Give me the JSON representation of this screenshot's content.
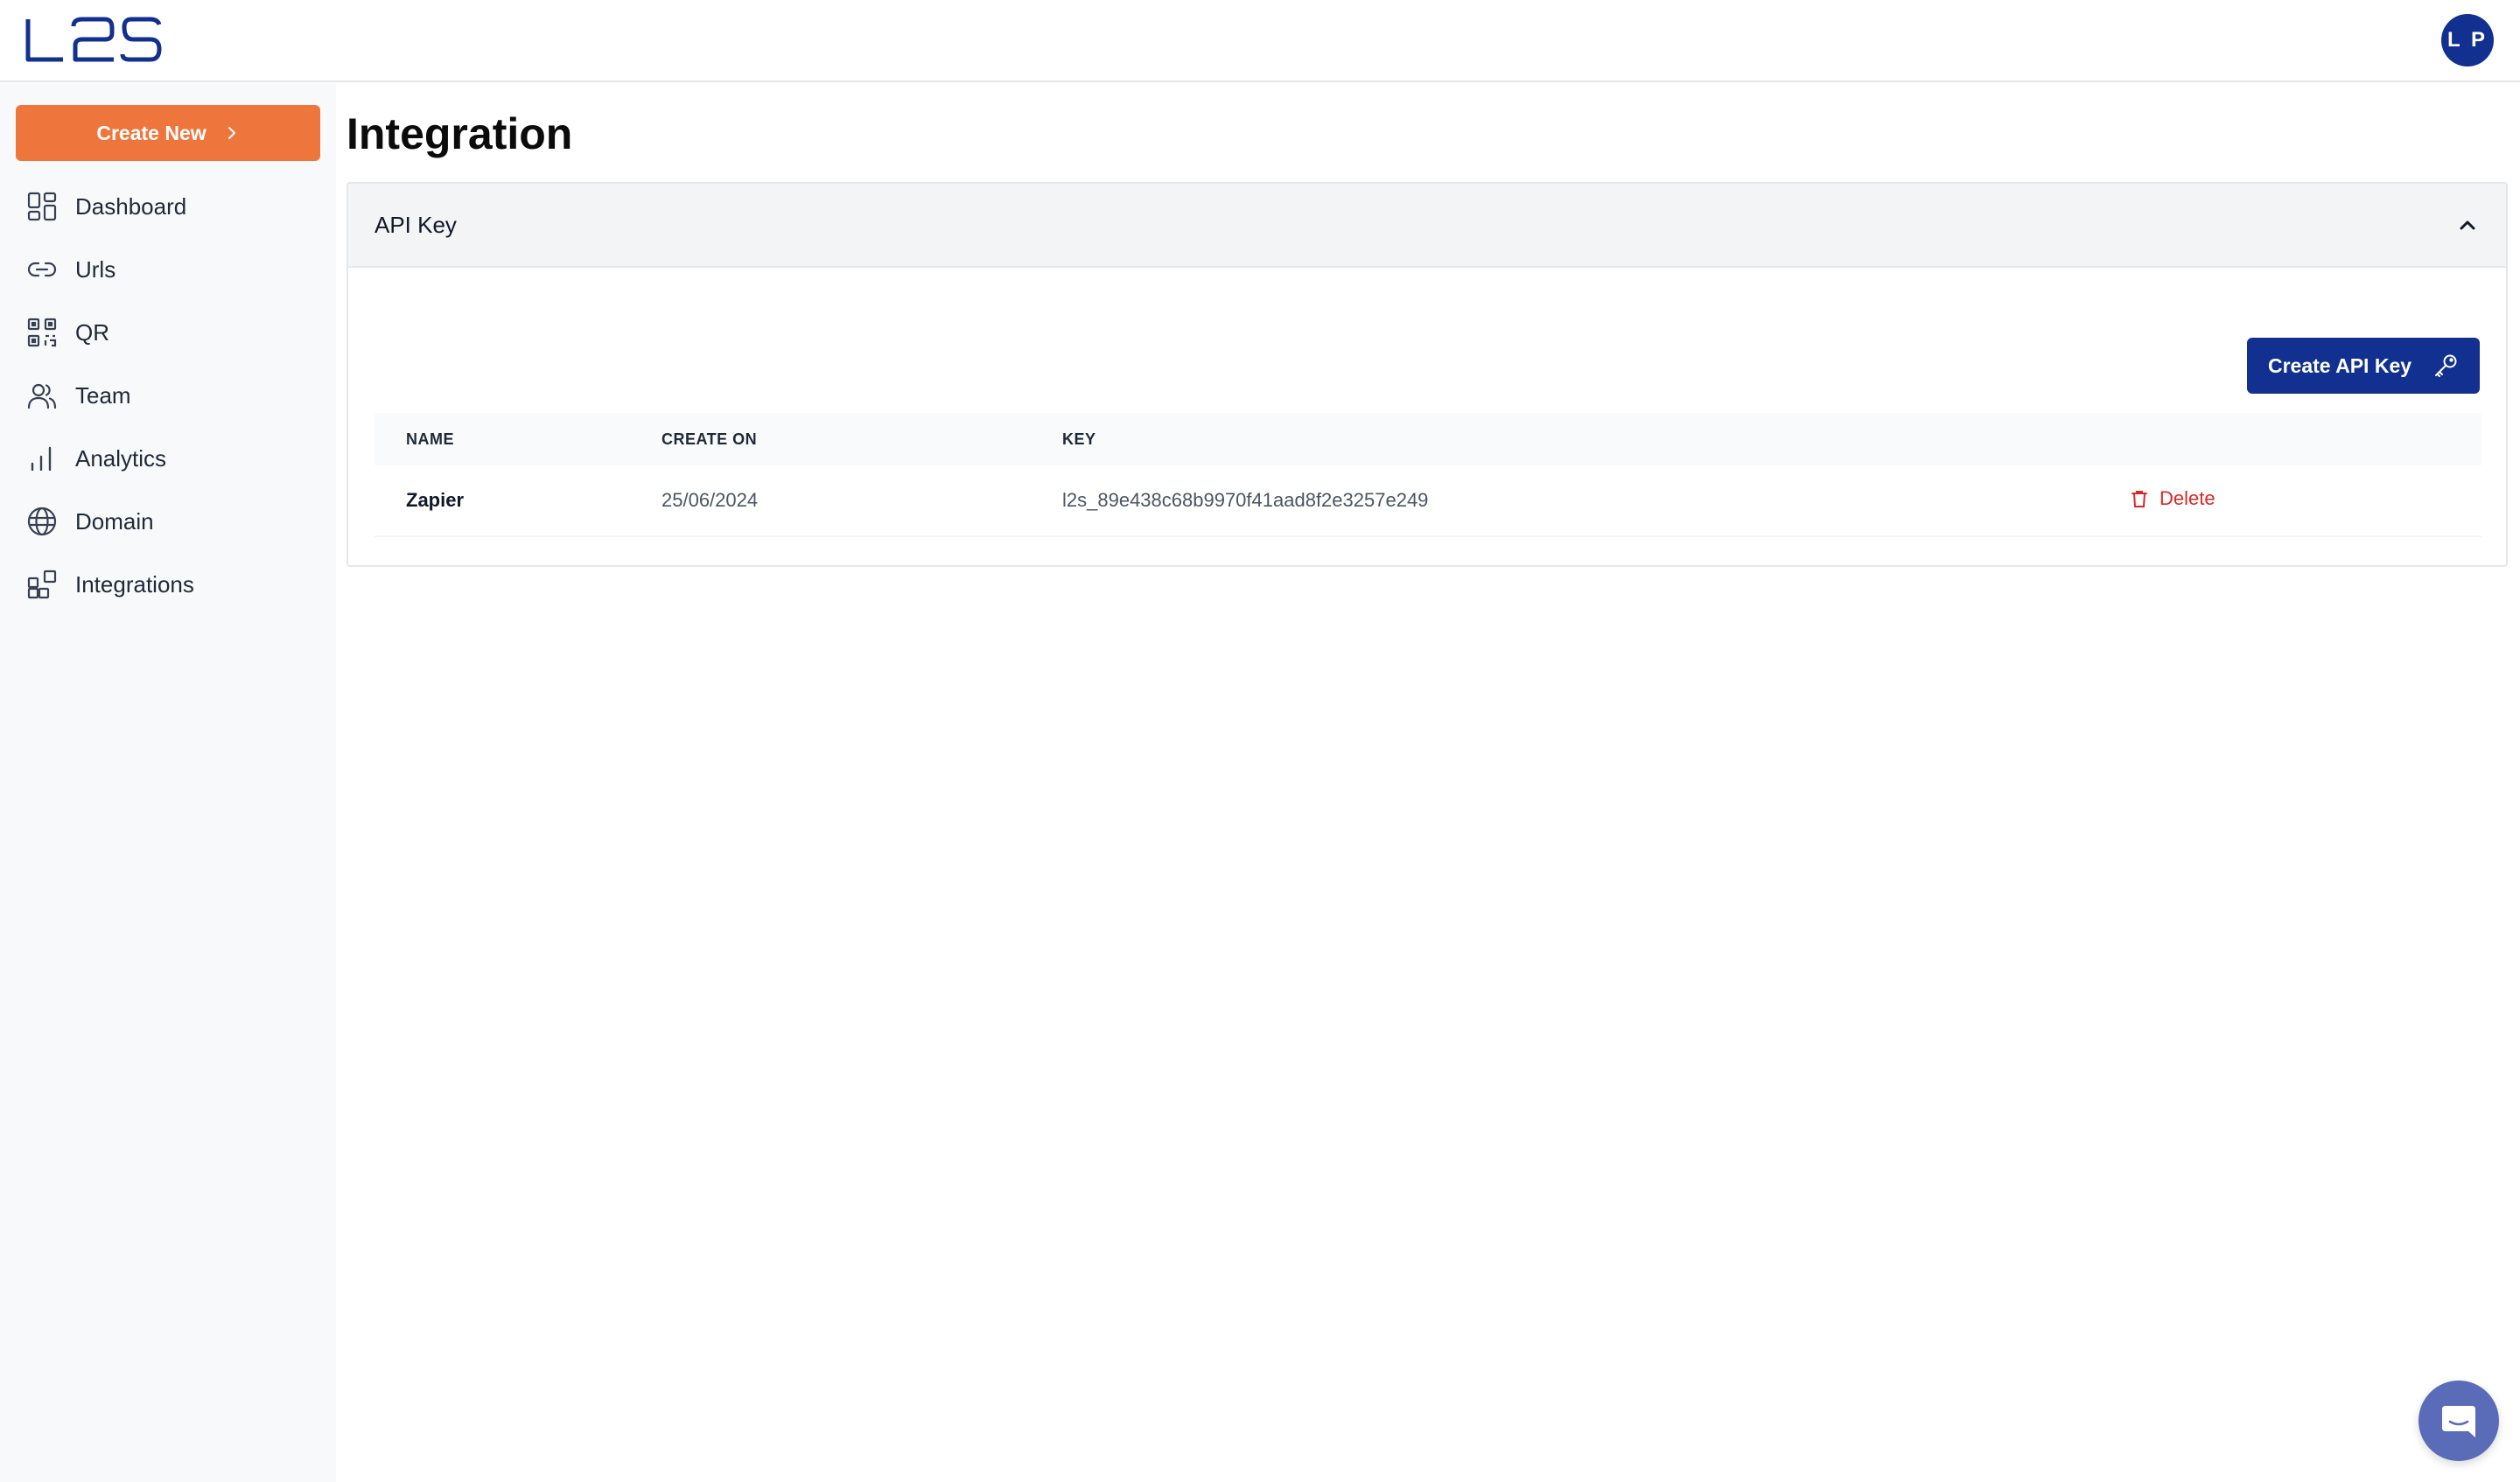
{
  "header": {
    "logo_text": "L2S",
    "avatar_initials": "L P"
  },
  "sidebar": {
    "create_new_label": "Create New",
    "items": [
      {
        "label": "Dashboard",
        "icon": "dashboard-icon"
      },
      {
        "label": "Urls",
        "icon": "link-icon"
      },
      {
        "label": "QR",
        "icon": "qr-icon"
      },
      {
        "label": "Team",
        "icon": "team-icon"
      },
      {
        "label": "Analytics",
        "icon": "analytics-icon"
      },
      {
        "label": "Domain",
        "icon": "globe-icon"
      },
      {
        "label": "Integrations",
        "icon": "integrations-icon"
      }
    ]
  },
  "main": {
    "title": "Integration",
    "panel": {
      "title": "API Key",
      "create_button_label": "Create API Key",
      "columns": [
        "NAME",
        "CREATE ON",
        "KEY"
      ],
      "rows": [
        {
          "name": "Zapier",
          "created_on": "25/06/2024",
          "key": "l2s_89e438c68b9970f41aad8f2e3257e249",
          "action": "Delete"
        }
      ]
    }
  },
  "colors": {
    "brand_blue": "#12308f",
    "accent_orange": "#ee763c",
    "danger": "#dc2626"
  }
}
